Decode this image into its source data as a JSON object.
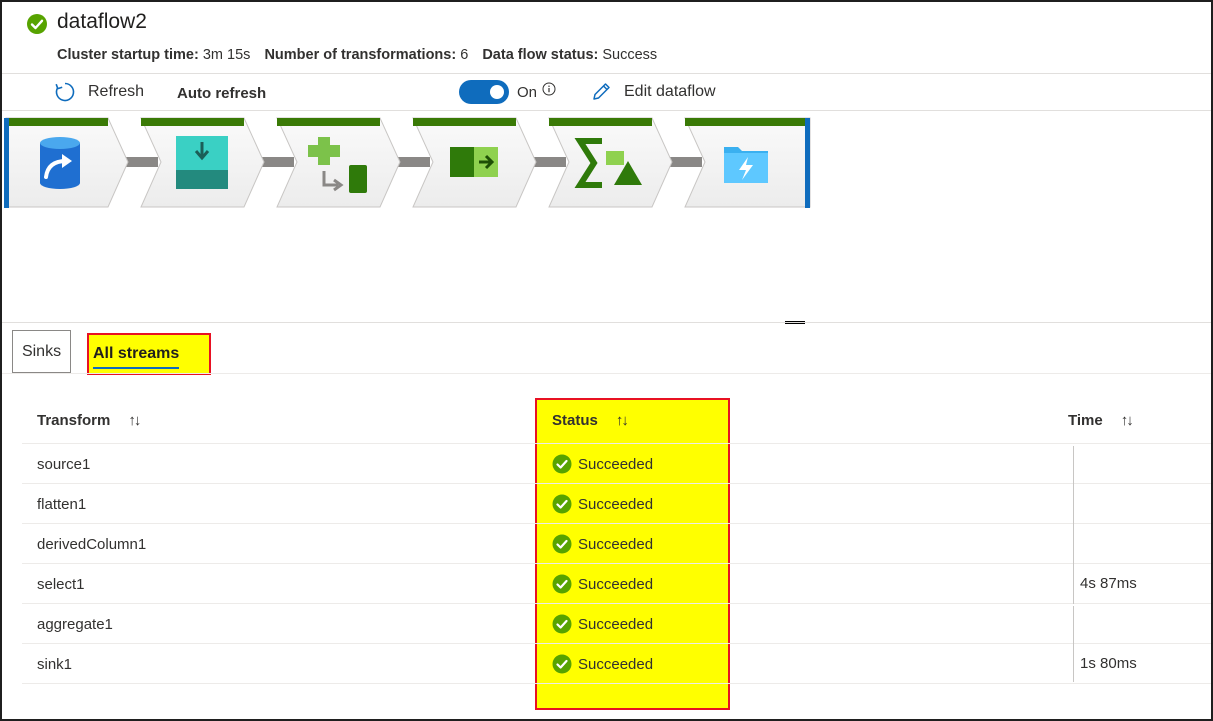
{
  "header": {
    "title": "dataflow2",
    "cluster_label": "Cluster startup time:",
    "cluster_value": "3m 15s",
    "transforms_label": "Number of transformations:",
    "transforms_value": "6",
    "status_label": "Data flow status:",
    "status_value": "Success"
  },
  "toolbar": {
    "refresh_label": "Refresh",
    "auto_refresh_label": "Auto refresh",
    "toggle_label": "On",
    "edit_label": "Edit dataflow"
  },
  "pipeline": {
    "steps": [
      {
        "name": "source",
        "icon": "source-database-icon"
      },
      {
        "name": "flatten",
        "icon": "flatten-icon"
      },
      {
        "name": "derived-column",
        "icon": "derived-column-icon"
      },
      {
        "name": "select",
        "icon": "select-icon"
      },
      {
        "name": "aggregate",
        "icon": "aggregate-icon"
      },
      {
        "name": "sink",
        "icon": "sink-folder-icon"
      }
    ]
  },
  "tabs": {
    "sinks": "Sinks",
    "all_streams": "All streams"
  },
  "table": {
    "columns": {
      "transform": "Transform",
      "status": "Status",
      "time": "Time"
    },
    "rows": [
      {
        "transform": "source1",
        "status": "Succeeded"
      },
      {
        "transform": "flatten1",
        "status": "Succeeded"
      },
      {
        "transform": "derivedColumn1",
        "status": "Succeeded"
      },
      {
        "transform": "select1",
        "status": "Succeeded"
      },
      {
        "transform": "aggregate1",
        "status": "Succeeded"
      },
      {
        "transform": "sink1",
        "status": "Succeeded"
      }
    ],
    "times": [
      "4s 87ms",
      "1s 80ms"
    ]
  },
  "colors": {
    "success": "#57a300",
    "accent": "#0f6cbd",
    "highlight": "#ffff00",
    "highlight_border": "#e81123",
    "pipeline_bar": "#3a7a06"
  }
}
